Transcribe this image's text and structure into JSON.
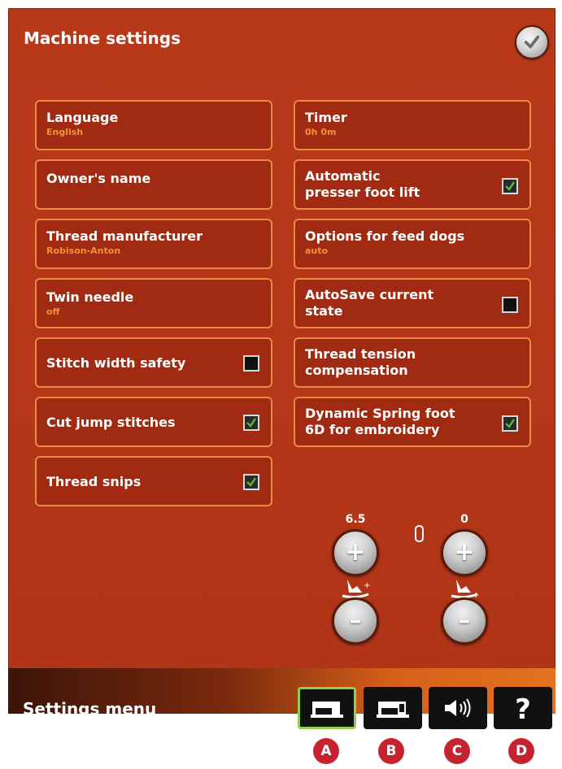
{
  "header": {
    "title": "Machine settings"
  },
  "left_settings": [
    {
      "label": "Language",
      "value": "English"
    },
    {
      "label": "Owner's name"
    },
    {
      "label": "Thread manufacturer",
      "value": "Robison-Anton"
    },
    {
      "label": "Twin needle",
      "value": "off"
    },
    {
      "label": "Stitch width safety",
      "checked": false
    },
    {
      "label": "Cut jump stitches",
      "checked": true
    },
    {
      "label": "Thread snips",
      "checked": true
    }
  ],
  "right_settings": [
    {
      "label": "Timer",
      "value": "0h 0m"
    },
    {
      "label": "Automatic\npresser foot lift",
      "checked": true
    },
    {
      "label": "Options for feed dogs",
      "value": "auto"
    },
    {
      "label": "AutoSave current\nstate",
      "checked": false
    },
    {
      "label": "Thread tension\ncompensation"
    },
    {
      "label": "Dynamic Spring foot\n6D for embroidery",
      "checked": true
    }
  ],
  "adjusters": {
    "presser_foot_height": {
      "value": "6.5"
    },
    "presser_foot_pressure": {
      "value": "0"
    }
  },
  "footer": {
    "title": "Settings menu",
    "tabs": [
      {
        "name": "machine-settings",
        "icon": "sewing-machine-icon",
        "active": true
      },
      {
        "name": "machine-options",
        "icon": "sewing-machine-embroidery-icon",
        "active": false
      },
      {
        "name": "sound-settings",
        "icon": "speaker-icon",
        "active": false
      },
      {
        "name": "help",
        "icon": "question-icon",
        "active": false
      }
    ]
  },
  "markers": [
    "A",
    "B",
    "C",
    "D"
  ],
  "colors": {
    "background": "#b8391a",
    "panel": "#a02b12",
    "panel_border": "#e98b43",
    "subtext": "#f0923a",
    "check_green": "#5dc23a",
    "active_tab_border": "#8ed04b",
    "marker": "#c4232f"
  }
}
